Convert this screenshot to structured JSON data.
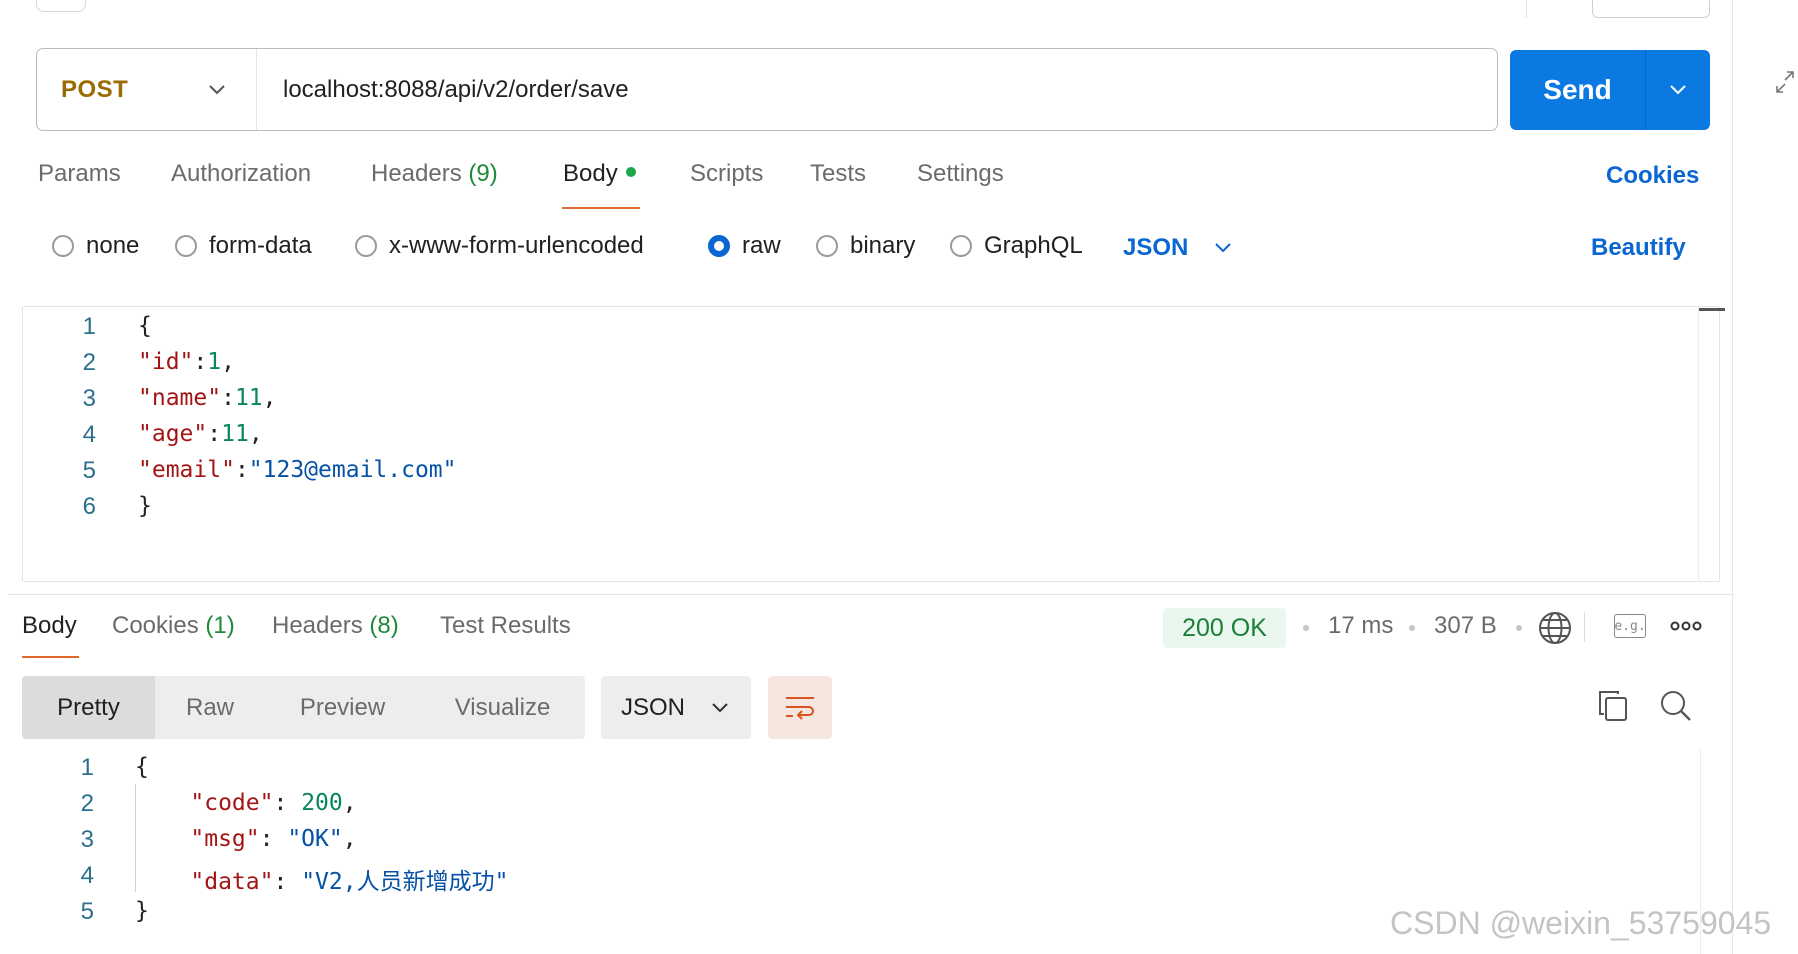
{
  "request": {
    "method": "POST",
    "url": "localhost:8088/api/v2/order/save",
    "send_label": "Send"
  },
  "request_tabs": [
    {
      "label": "Params"
    },
    {
      "label": "Authorization"
    },
    {
      "label": "Headers",
      "count": "(9)"
    },
    {
      "label": "Body",
      "active": true
    },
    {
      "label": "Scripts"
    },
    {
      "label": "Tests"
    },
    {
      "label": "Settings"
    }
  ],
  "cookies_label": "Cookies",
  "body_types": [
    {
      "label": "none"
    },
    {
      "label": "form-data"
    },
    {
      "label": "x-www-form-urlencoded"
    },
    {
      "label": "raw",
      "selected": true
    },
    {
      "label": "binary"
    },
    {
      "label": "GraphQL"
    }
  ],
  "body_format": "JSON",
  "beautify_label": "Beautify",
  "request_body": {
    "line_numbers": [
      "1",
      "2",
      "3",
      "4",
      "5",
      "6"
    ],
    "lines": [
      [
        {
          "t": "{",
          "c": "p"
        }
      ],
      [
        {
          "t": "\"id\"",
          "c": "k"
        },
        {
          "t": ":",
          "c": "p"
        },
        {
          "t": "1",
          "c": "n"
        },
        {
          "t": ",",
          "c": "p"
        }
      ],
      [
        {
          "t": "\"name\"",
          "c": "k"
        },
        {
          "t": ":",
          "c": "p"
        },
        {
          "t": "11",
          "c": "n"
        },
        {
          "t": ",",
          "c": "p"
        }
      ],
      [
        {
          "t": "\"age\"",
          "c": "k"
        },
        {
          "t": ":",
          "c": "p"
        },
        {
          "t": "11",
          "c": "n"
        },
        {
          "t": ",",
          "c": "p"
        }
      ],
      [
        {
          "t": "\"email\"",
          "c": "k"
        },
        {
          "t": ":",
          "c": "p"
        },
        {
          "t": "\"123@email.com\"",
          "c": "s"
        }
      ],
      [
        {
          "t": "}",
          "c": "p"
        }
      ]
    ]
  },
  "response_tabs": [
    {
      "label": "Body",
      "active": true
    },
    {
      "label": "Cookies",
      "count": "(1)"
    },
    {
      "label": "Headers",
      "count": "(8)"
    },
    {
      "label": "Test Results"
    }
  ],
  "response_meta": {
    "status": "200 OK",
    "time": "17 ms",
    "size": "307 B",
    "example_label": "e.g."
  },
  "response_views": [
    "Pretty",
    "Raw",
    "Preview",
    "Visualize"
  ],
  "response_format": "JSON",
  "response_body": {
    "line_numbers": [
      "1",
      "2",
      "3",
      "4",
      "5"
    ],
    "lines": [
      [
        {
          "t": "{",
          "c": "p"
        }
      ],
      [
        {
          "t": "    \"code\"",
          "c": "k"
        },
        {
          "t": ": ",
          "c": "p"
        },
        {
          "t": "200",
          "c": "n"
        },
        {
          "t": ",",
          "c": "p"
        }
      ],
      [
        {
          "t": "    \"msg\"",
          "c": "k"
        },
        {
          "t": ": ",
          "c": "p"
        },
        {
          "t": "\"OK\"",
          "c": "s"
        },
        {
          "t": ",",
          "c": "p"
        }
      ],
      [
        {
          "t": "    \"data\"",
          "c": "k"
        },
        {
          "t": ": ",
          "c": "p"
        },
        {
          "t": "\"V2,人员新增成功\"",
          "c": "s"
        }
      ],
      [
        {
          "t": "}",
          "c": "p"
        }
      ]
    ]
  },
  "watermark": "CSDN @weixin_53759045",
  "colors": {
    "accent_blue": "#0a7ae2",
    "link_blue": "#0a66d0",
    "method_post": "#9a6b00",
    "active_underline": "#e0692d",
    "status_green": "#1a7f37"
  }
}
